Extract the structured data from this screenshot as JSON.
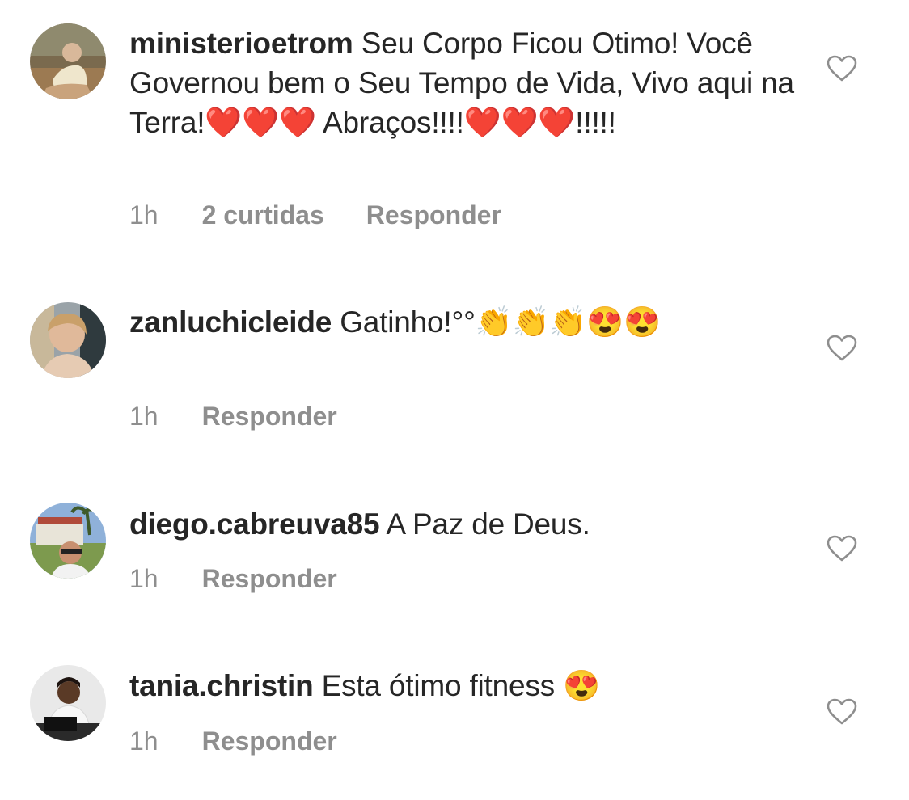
{
  "comments": [
    {
      "username": "ministerioetrom",
      "text": "Seu Corpo Ficou Otimo! Você Governou bem o Seu Tempo de Vida, Vivo aqui na Terra!❤️❤️❤️ Abraços!!!!❤️❤️❤️!!!!!",
      "time": "1h",
      "likes": "2 curtidas",
      "reply": "Responder",
      "avatar_icon": "user-avatar-photo",
      "like_icon": "heart-outline-icon"
    },
    {
      "username": "zanluchicleide",
      "text": "Gatinho!°°👏👏👏😍😍",
      "time": "1h",
      "likes": "",
      "reply": "Responder",
      "avatar_icon": "user-avatar-photo",
      "like_icon": "heart-outline-icon"
    },
    {
      "username": "diego.cabreuva85",
      "text": "A Paz de Deus.",
      "time": "1h",
      "likes": "",
      "reply": "Responder",
      "avatar_icon": "user-avatar-photo",
      "like_icon": "heart-outline-icon"
    },
    {
      "username": "tania.christin",
      "text": "Esta ótimo fitness 😍",
      "time": "1h",
      "likes": "",
      "reply": "Responder",
      "avatar_icon": "user-avatar-photo",
      "like_icon": "heart-outline-icon"
    }
  ],
  "colors": {
    "text": "#262626",
    "meta": "#8e8e8e",
    "background": "#ffffff"
  }
}
